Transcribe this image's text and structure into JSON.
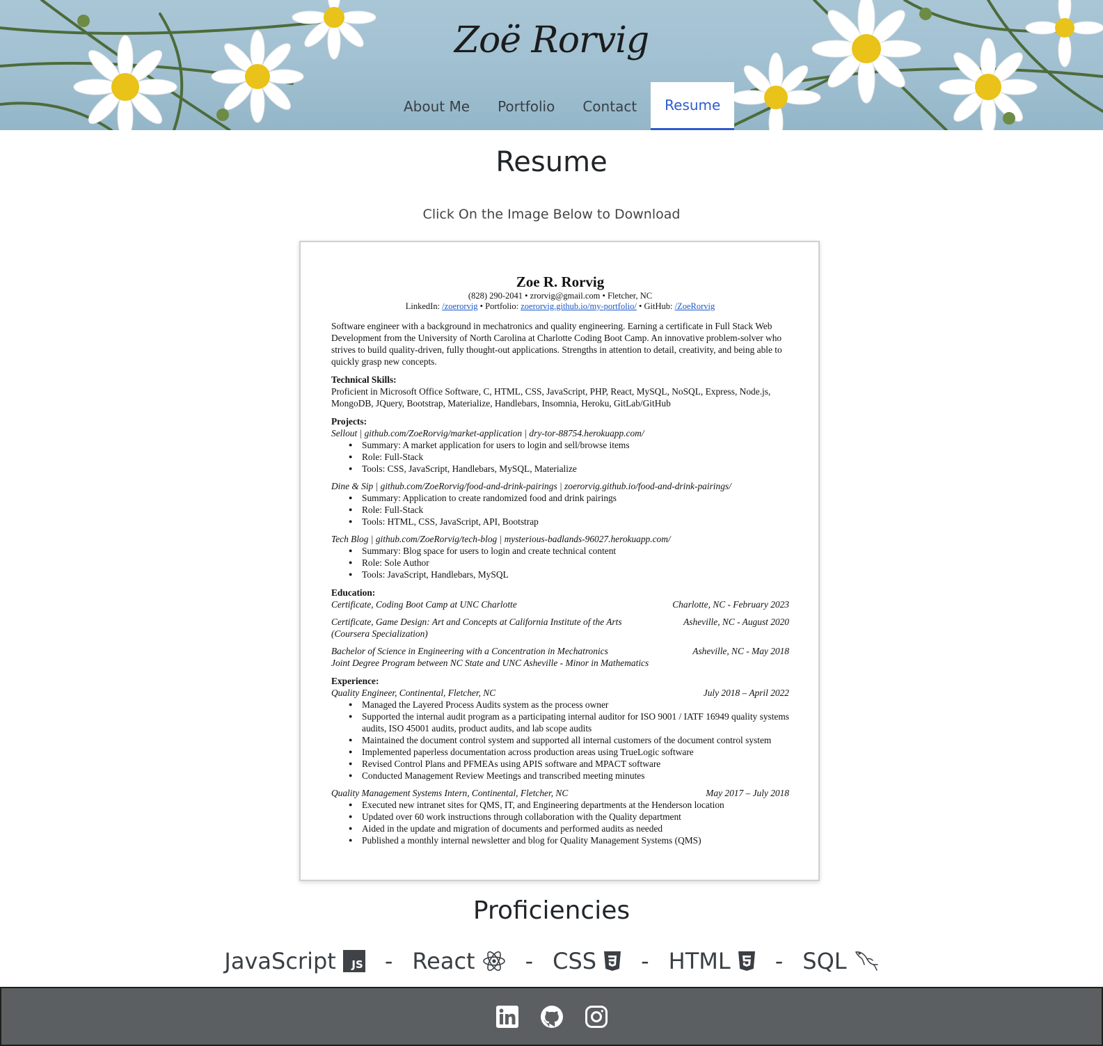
{
  "site": {
    "title": "Zoë Rorvig"
  },
  "nav": {
    "items": [
      {
        "label": "About Me"
      },
      {
        "label": "Portfolio"
      },
      {
        "label": "Contact"
      },
      {
        "label": "Resume"
      }
    ],
    "active": "Resume"
  },
  "main": {
    "heading": "Resume",
    "download_note": "Click On the Image Below to Download"
  },
  "resume": {
    "name": "Zoe R. Rorvig",
    "contact": "(828) 290-2041 • zrorvig@gmail.com • Fletcher, NC",
    "links_prefix_linkedin": "LinkedIn: ",
    "linkedin": "/zoerorvig",
    "links_prefix_portfolio": " • Portfolio: ",
    "portfolio": "zoerorvig.github.io/my-portfolio/",
    "links_prefix_github": " • GitHub: ",
    "github": "/ZoeRorvig",
    "summary": "Software engineer with a background in mechatronics and quality engineering. Earning a certificate in Full Stack Web Development from the University of North Carolina at Charlotte Coding Boot Camp. An innovative problem-solver who strives to build quality-driven, fully thought-out applications. Strengths in attention to detail, creativity, and being able to quickly grasp new concepts.",
    "skills_heading": "Technical Skills:",
    "skills": "Proficient in Microsoft Office Software, C, HTML, CSS, JavaScript, PHP, React, MySQL, NoSQL, Express, Node.js, MongoDB, JQuery, Bootstrap, Materialize, Handlebars, Insomnia, Heroku, GitLab/GitHub",
    "projects_heading": "Projects:",
    "projects": [
      {
        "title": "Sellout | github.com/ZoeRorvig/market-application | dry-tor-88754.herokuapp.com/",
        "bullets": [
          "Summary: A market application for users to login and sell/browse items",
          "Role: Full-Stack",
          "Tools: CSS, JavaScript, Handlebars, MySQL, Materialize"
        ]
      },
      {
        "title": "Dine & Sip | github.com/ZoeRorvig/food-and-drink-pairings | zoerorvig.github.io/food-and-drink-pairings/",
        "bullets": [
          "Summary: Application to create randomized food and drink pairings",
          "Role: Full-Stack",
          "Tools: HTML, CSS, JavaScript, API, Bootstrap"
        ]
      },
      {
        "title": "Tech Blog | github.com/ZoeRorvig/tech-blog | mysterious-badlands-96027.herokuapp.com/",
        "bullets": [
          "Summary: Blog space for users to login and create technical content",
          "Role: Sole Author",
          "Tools: JavaScript, Handlebars, MySQL"
        ]
      }
    ],
    "education_heading": "Education:",
    "education": [
      {
        "left": "Certificate, Coding Boot Camp at UNC Charlotte",
        "right": "Charlotte, NC - February 2023",
        "sub": ""
      },
      {
        "left": "Certificate, Game Design: Art and Concepts at California Institute of the Arts",
        "right": "Asheville, NC -  August 2020",
        "sub": "(Coursera Specialization)"
      },
      {
        "left": "Bachelor of Science in Engineering with a Concentration in Mechatronics",
        "right": "Asheville, NC - May 2018",
        "sub": "Joint Degree Program between NC State and UNC Asheville - Minor in Mathematics"
      }
    ],
    "experience_heading": "Experience:",
    "experience": [
      {
        "left": "Quality Engineer, Continental, Fletcher, NC",
        "right": "July 2018 – April 2022",
        "bullets": [
          "Managed the Layered Process Audits system as the process owner",
          "Supported the internal audit program as a participating internal auditor for ISO 9001 / IATF 16949 quality systems audits, ISO 45001 audits, product audits, and lab scope audits",
          "Maintained the document control system and supported all internal customers of the document control system",
          "Implemented paperless documentation across production areas using TrueLogic software",
          "Revised Control Plans and PFMEAs using APIS software and MPACT software",
          "Conducted Management Review Meetings and transcribed meeting minutes"
        ]
      },
      {
        "left": "Quality Management Systems Intern, Continental, Fletcher, NC",
        "right": "May 2017 – July 2018",
        "bullets": [
          "Executed new intranet sites for QMS, IT, and Engineering departments at the Henderson location",
          "Updated over 60 work instructions through collaboration with the Quality department",
          "Aided in the update and migration of documents and performed audits as needed",
          "Published a monthly internal newsletter and blog for Quality Management Systems (QMS)"
        ]
      }
    ]
  },
  "proficiencies": {
    "heading": "Proficiencies",
    "separator": "-",
    "items": [
      {
        "label": "JavaScript",
        "icon": "javascript-icon",
        "badge": "JS"
      },
      {
        "label": "React",
        "icon": "react-icon"
      },
      {
        "label": "CSS",
        "icon": "css3-icon"
      },
      {
        "label": "HTML",
        "icon": "html5-icon"
      },
      {
        "label": "SQL",
        "icon": "mysql-dolphin-icon"
      }
    ]
  },
  "footer": {
    "icons": [
      "linkedin-icon",
      "github-icon",
      "instagram-icon"
    ]
  },
  "colors": {
    "header_sky": "#a9c6d6",
    "nav_active": "#2d5bd0",
    "footer_bg": "#5c5f62",
    "text_dark": "#212529"
  }
}
